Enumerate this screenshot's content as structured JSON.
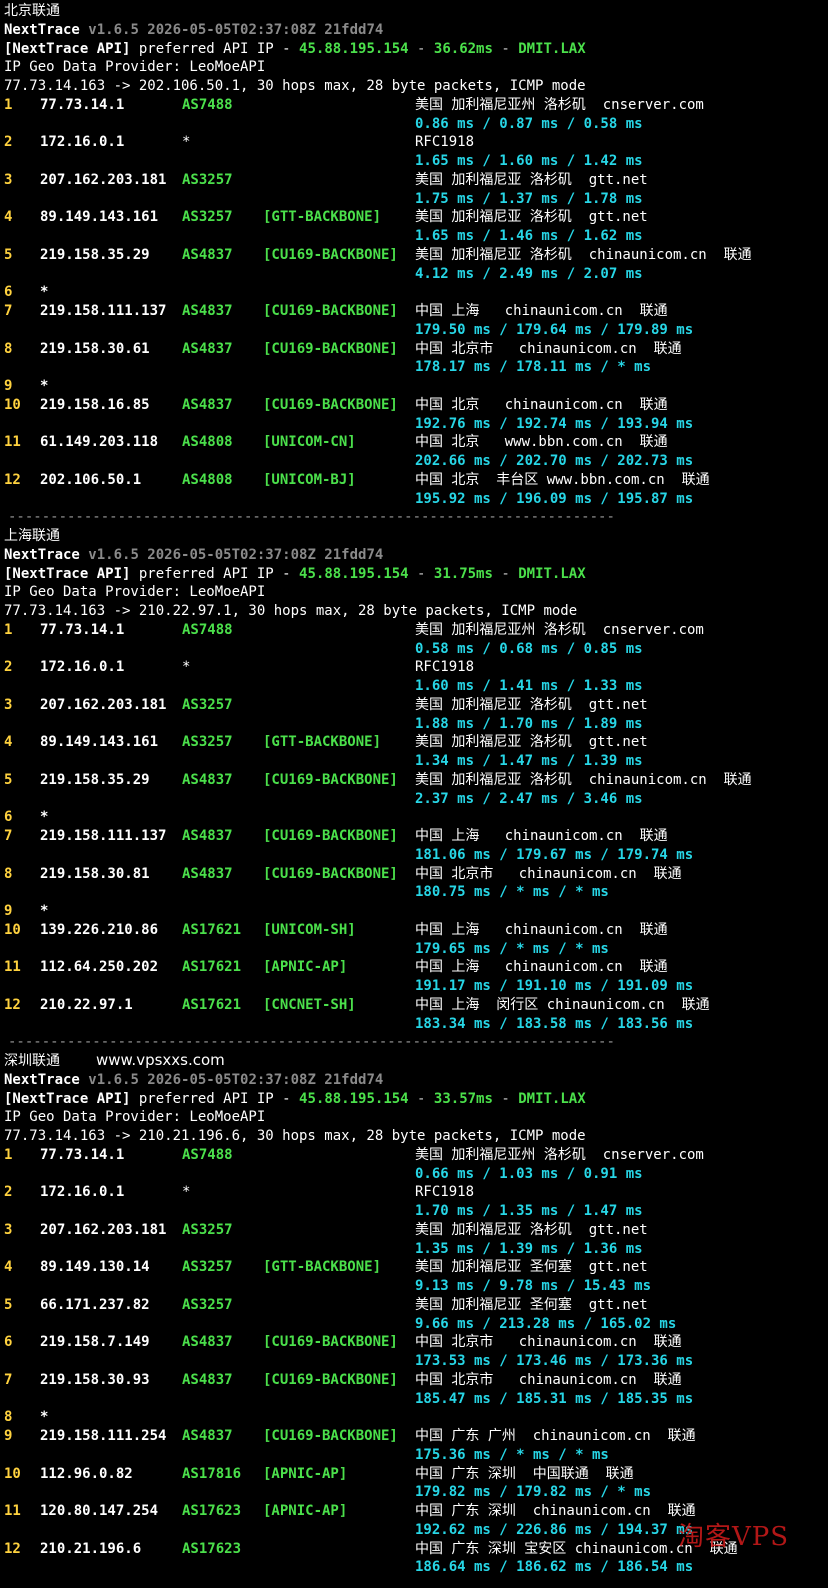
{
  "sections": [
    {
      "title": "北京联通",
      "site_watermark": "",
      "app": "NextTrace",
      "version": "v1.6.5 2026-05-05T02:37:08Z 21fdd74",
      "api_prefix": "[NextTrace API]",
      "api_text": "preferred API IP -",
      "api_ip": "45.88.195.154",
      "api_latency": "36.62ms",
      "api_node": "DMIT.LAX",
      "geo_provider": "IP Geo Data Provider: LeoMoeAPI",
      "header": "77.73.14.163 -> 202.106.50.1, 30 hops max, 28 byte packets, ICMP mode",
      "hops": [
        {
          "n": "1",
          "ip": "77.73.14.1",
          "asn": "AS7488",
          "tag": "",
          "geo": "美国 加利福尼亚州 洛杉矶  cnserver.com",
          "rtt": "0.86 ms / 0.87 ms / 0.58 ms"
        },
        {
          "n": "2",
          "ip": "172.16.0.1",
          "asn": "*",
          "tag": "",
          "geo": "RFC1918",
          "rtt": "1.65 ms / 1.60 ms / 1.42 ms"
        },
        {
          "n": "3",
          "ip": "207.162.203.181",
          "asn": "AS3257",
          "tag": "",
          "geo": "美国 加利福尼亚 洛杉矶  gtt.net",
          "rtt": "1.75 ms / 1.37 ms / 1.78 ms"
        },
        {
          "n": "4",
          "ip": "89.149.143.161",
          "asn": "AS3257",
          "tag": "[GTT-BACKBONE]",
          "geo": "美国 加利福尼亚 洛杉矶  gtt.net",
          "rtt": "1.65 ms / 1.46 ms / 1.62 ms"
        },
        {
          "n": "5",
          "ip": "219.158.35.29",
          "asn": "AS4837",
          "tag": "[CU169-BACKBONE]",
          "geo": "美国 加利福尼亚 洛杉矶  chinaunicom.cn  联通",
          "rtt": "4.12 ms / 2.49 ms / 2.07 ms"
        },
        {
          "n": "6",
          "ip": "*",
          "asn": "",
          "tag": "",
          "geo": "",
          "rtt": ""
        },
        {
          "n": "7",
          "ip": "219.158.111.137",
          "asn": "AS4837",
          "tag": "[CU169-BACKBONE]",
          "geo": "中国 上海   chinaunicom.cn  联通",
          "rtt": "179.50 ms / 179.64 ms / 179.89 ms"
        },
        {
          "n": "8",
          "ip": "219.158.30.61",
          "asn": "AS4837",
          "tag": "[CU169-BACKBONE]",
          "geo": "中国 北京市   chinaunicom.cn  联通",
          "rtt": "178.17 ms / 178.11 ms / * ms"
        },
        {
          "n": "9",
          "ip": "*",
          "asn": "",
          "tag": "",
          "geo": "",
          "rtt": ""
        },
        {
          "n": "10",
          "ip": "219.158.16.85",
          "asn": "AS4837",
          "tag": "[CU169-BACKBONE]",
          "geo": "中国 北京   chinaunicom.cn  联通",
          "rtt": "192.76 ms / 192.74 ms / 193.94 ms"
        },
        {
          "n": "11",
          "ip": "61.149.203.118",
          "asn": "AS4808",
          "tag": "[UNICOM-CN]",
          "geo": "中国 北京   www.bbn.com.cn  联通",
          "rtt": "202.66 ms / 202.70 ms / 202.73 ms"
        },
        {
          "n": "12",
          "ip": "202.106.50.1",
          "asn": "AS4808",
          "tag": "[UNICOM-BJ]",
          "geo": "中国 北京  丰台区 www.bbn.com.cn  联通",
          "rtt": "195.92 ms / 196.09 ms / 195.87 ms"
        }
      ]
    },
    {
      "title": "上海联通",
      "site_watermark": "",
      "app": "NextTrace",
      "version": "v1.6.5 2026-05-05T02:37:08Z 21fdd74",
      "api_prefix": "[NextTrace API]",
      "api_text": "preferred API IP -",
      "api_ip": "45.88.195.154",
      "api_latency": "31.75ms",
      "api_node": "DMIT.LAX",
      "geo_provider": "IP Geo Data Provider: LeoMoeAPI",
      "header": "77.73.14.163 -> 210.22.97.1, 30 hops max, 28 byte packets, ICMP mode",
      "hops": [
        {
          "n": "1",
          "ip": "77.73.14.1",
          "asn": "AS7488",
          "tag": "",
          "geo": "美国 加利福尼亚州 洛杉矶  cnserver.com",
          "rtt": "0.58 ms / 0.68 ms / 0.85 ms"
        },
        {
          "n": "2",
          "ip": "172.16.0.1",
          "asn": "*",
          "tag": "",
          "geo": "RFC1918",
          "rtt": "1.60 ms / 1.41 ms / 1.33 ms"
        },
        {
          "n": "3",
          "ip": "207.162.203.181",
          "asn": "AS3257",
          "tag": "",
          "geo": "美国 加利福尼亚 洛杉矶  gtt.net",
          "rtt": "1.88 ms / 1.70 ms / 1.89 ms"
        },
        {
          "n": "4",
          "ip": "89.149.143.161",
          "asn": "AS3257",
          "tag": "[GTT-BACKBONE]",
          "geo": "美国 加利福尼亚 洛杉矶  gtt.net",
          "rtt": "1.34 ms / 1.47 ms / 1.39 ms"
        },
        {
          "n": "5",
          "ip": "219.158.35.29",
          "asn": "AS4837",
          "tag": "[CU169-BACKBONE]",
          "geo": "美国 加利福尼亚 洛杉矶  chinaunicom.cn  联通",
          "rtt": "2.37 ms / 2.47 ms / 3.46 ms"
        },
        {
          "n": "6",
          "ip": "*",
          "asn": "",
          "tag": "",
          "geo": "",
          "rtt": ""
        },
        {
          "n": "7",
          "ip": "219.158.111.137",
          "asn": "AS4837",
          "tag": "[CU169-BACKBONE]",
          "geo": "中国 上海   chinaunicom.cn  联通",
          "rtt": "181.06 ms / 179.67 ms / 179.74 ms"
        },
        {
          "n": "8",
          "ip": "219.158.30.81",
          "asn": "AS4837",
          "tag": "[CU169-BACKBONE]",
          "geo": "中国 北京市   chinaunicom.cn  联通",
          "rtt": "180.75 ms / * ms / * ms"
        },
        {
          "n": "9",
          "ip": "*",
          "asn": "",
          "tag": "",
          "geo": "",
          "rtt": ""
        },
        {
          "n": "10",
          "ip": "139.226.210.86",
          "asn": "AS17621",
          "tag": "[UNICOM-SH]",
          "geo": "中国 上海   chinaunicom.cn  联通",
          "rtt": "179.65 ms / * ms / * ms"
        },
        {
          "n": "11",
          "ip": "112.64.250.202",
          "asn": "AS17621",
          "tag": "[APNIC-AP]",
          "geo": "中国 上海   chinaunicom.cn  联通",
          "rtt": "191.17 ms / 191.10 ms / 191.09 ms"
        },
        {
          "n": "12",
          "ip": "210.22.97.1",
          "asn": "AS17621",
          "tag": "[CNCNET-SH]",
          "geo": "中国 上海  闵行区 chinaunicom.cn  联通",
          "rtt": "183.34 ms / 183.58 ms / 183.56 ms"
        }
      ]
    },
    {
      "title": "深圳联通",
      "site_watermark": "www.vpsxxs.com",
      "app": "NextTrace",
      "version": "v1.6.5 2026-05-05T02:37:08Z 21fdd74",
      "api_prefix": "[NextTrace API]",
      "api_text": "preferred API IP -",
      "api_ip": "45.88.195.154",
      "api_latency": "33.57ms",
      "api_node": "DMIT.LAX",
      "geo_provider": "IP Geo Data Provider: LeoMoeAPI",
      "header": "77.73.14.163 -> 210.21.196.6, 30 hops max, 28 byte packets, ICMP mode",
      "hops": [
        {
          "n": "1",
          "ip": "77.73.14.1",
          "asn": "AS7488",
          "tag": "",
          "geo": "美国 加利福尼亚州 洛杉矶  cnserver.com",
          "rtt": "0.66 ms / 1.03 ms / 0.91 ms"
        },
        {
          "n": "2",
          "ip": "172.16.0.1",
          "asn": "*",
          "tag": "",
          "geo": "RFC1918",
          "rtt": "1.70 ms / 1.35 ms / 1.47 ms"
        },
        {
          "n": "3",
          "ip": "207.162.203.181",
          "asn": "AS3257",
          "tag": "",
          "geo": "美国 加利福尼亚 洛杉矶  gtt.net",
          "rtt": "1.35 ms / 1.39 ms / 1.36 ms"
        },
        {
          "n": "4",
          "ip": "89.149.130.14",
          "asn": "AS3257",
          "tag": "[GTT-BACKBONE]",
          "geo": "美国 加利福尼亚 圣何塞  gtt.net",
          "rtt": "9.13 ms / 9.78 ms / 15.43 ms"
        },
        {
          "n": "5",
          "ip": "66.171.237.82",
          "asn": "AS3257",
          "tag": "",
          "geo": "美国 加利福尼亚 圣何塞  gtt.net",
          "rtt": "9.66 ms / 213.28 ms / 165.02 ms"
        },
        {
          "n": "6",
          "ip": "219.158.7.149",
          "asn": "AS4837",
          "tag": "[CU169-BACKBONE]",
          "geo": "中国 北京市   chinaunicom.cn  联通",
          "rtt": "173.53 ms / 173.46 ms / 173.36 ms"
        },
        {
          "n": "7",
          "ip": "219.158.30.93",
          "asn": "AS4837",
          "tag": "[CU169-BACKBONE]",
          "geo": "中国 北京市   chinaunicom.cn  联通",
          "rtt": "185.47 ms / 185.31 ms / 185.35 ms"
        },
        {
          "n": "8",
          "ip": "*",
          "asn": "",
          "tag": "",
          "geo": "",
          "rtt": ""
        },
        {
          "n": "9",
          "ip": "219.158.111.254",
          "asn": "AS4837",
          "tag": "[CU169-BACKBONE]",
          "geo": "中国 广东 广州  chinaunicom.cn  联通",
          "rtt": "175.36 ms / * ms / * ms"
        },
        {
          "n": "10",
          "ip": "112.96.0.82",
          "asn": "AS17816",
          "tag": "[APNIC-AP]",
          "geo": "中国 广东 深圳  中国联通  联通",
          "rtt": "179.82 ms / 179.82 ms / * ms"
        },
        {
          "n": "11",
          "ip": "120.80.147.254",
          "asn": "AS17623",
          "tag": "[APNIC-AP]",
          "geo": "中国 广东 深圳  chinaunicom.cn  联通",
          "rtt": "192.62 ms / 226.86 ms / 194.37 ms"
        },
        {
          "n": "12",
          "ip": "210.21.196.6",
          "asn": "AS17623",
          "tag": "",
          "geo": "中国 广东 深圳 宝安区 chinaunicom.cn  联通",
          "rtt": "186.64 ms / 186.62 ms / 186.54 ms"
        }
      ]
    }
  ],
  "separator": "------------------------------------------------------------------------",
  "logo_watermark": "淘客VPS",
  "colors": {
    "background": "#000000",
    "hop_number": "#ffd23f",
    "asn": "#4be04b",
    "rtt": "#27d6e6",
    "text": "#ffffff"
  }
}
